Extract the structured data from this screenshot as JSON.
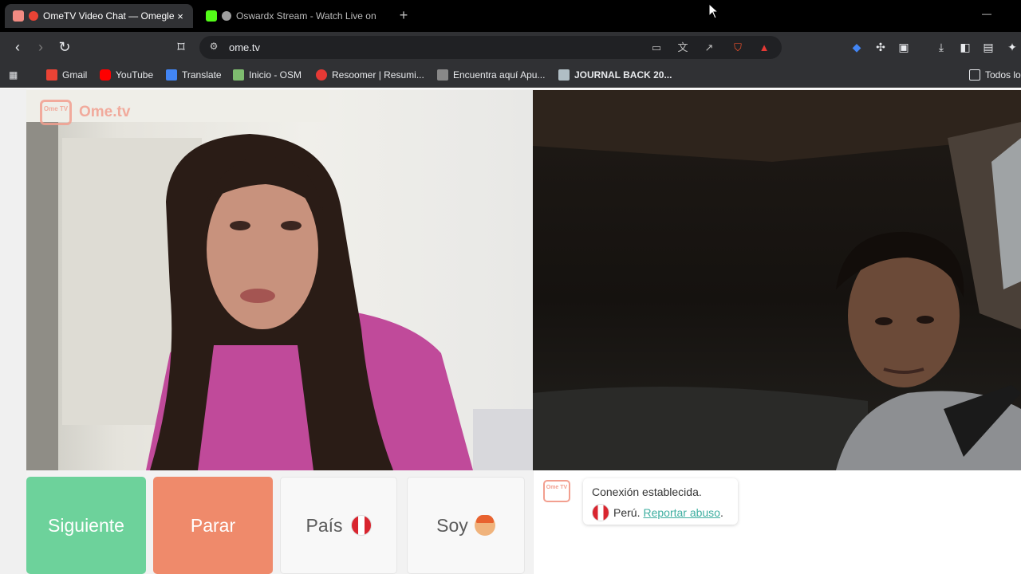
{
  "browser": {
    "tabs": [
      {
        "title": "OmeTV Video Chat — Omegle",
        "active": true,
        "close": "×"
      },
      {
        "title": "Oswardx Stream - Watch Live on",
        "active": false
      }
    ],
    "new_tab": "+",
    "window_min": "—",
    "address": "ome.tv",
    "bookmarks": [
      {
        "label": "Gmail",
        "color": "#ea4335"
      },
      {
        "label": "YouTube",
        "color": "#ff0000"
      },
      {
        "label": "Translate",
        "color": "#4285f4"
      },
      {
        "label": "Inicio - OSM",
        "color": "#7ebc6f"
      },
      {
        "label": "Resoomer | Resumi...",
        "color": "#e53935"
      },
      {
        "label": "Encuentra aquí Apu...",
        "color": "#888888"
      },
      {
        "label": "JOURNAL BACK 20...",
        "color": "#b0bec5"
      },
      {
        "label": "Todos los",
        "color": "#e8eaed"
      }
    ]
  },
  "site": {
    "logo_box": "Ome TV",
    "logo_text": "Ome.tv",
    "brand_color": "#f29f8f"
  },
  "controls": {
    "next": "Siguiente",
    "stop": "Parar",
    "country": "País",
    "gender": "Soy",
    "next_color": "#6dd29b",
    "stop_color": "#ef8a6b"
  },
  "chat": {
    "status": "Conexión establecida.",
    "country": "Perú.",
    "report": "Reportar abuso",
    "report_suffix": ".",
    "report_color": "#3eaea0"
  }
}
